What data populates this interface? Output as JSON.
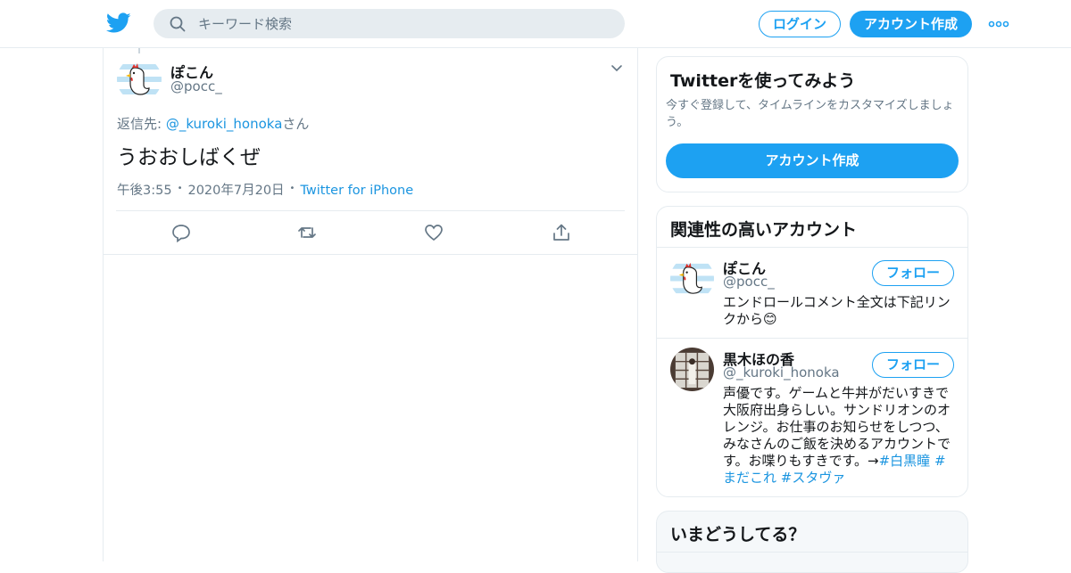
{
  "header": {
    "search_placeholder": "キーワード検索",
    "login_label": "ログイン",
    "signup_label": "アカウント作成"
  },
  "tweet": {
    "author_name": "ぽこん",
    "author_handle": "@pocc_",
    "reply_prefix": "返信先: ",
    "reply_handle": "@_kuroki_honoka",
    "reply_suffix": "さん",
    "text": "うおおしばくぜ",
    "time": "午後3:55",
    "date": "2020年7月20日",
    "source": "Twitter for iPhone"
  },
  "signup_card": {
    "title": "Twitterを使ってみよう",
    "description": "今すぐ登録して、タイムラインをカスタマイズしましょう。",
    "button_label": "アカウント作成"
  },
  "related": {
    "title": "関連性の高いアカウント",
    "follow_label": "フォロー",
    "accounts": [
      {
        "name": "ぽこん",
        "handle": "@pocc_",
        "bio": "エンドロールコメント全文は下記リンクから😊"
      },
      {
        "name": "黒木ほの香",
        "handle": "@_kuroki_honoka",
        "bio": "声優です。ゲームと牛丼がだいすきで大阪府出身らしい。サンドリオンのオレンジ。お仕事のお知らせをしつつ、みなさんのご飯を決めるアカウントです。お喋りもすきです。→",
        "tag1": "#白黒瞳",
        "tag2": "#まだこれ",
        "tag3": "#スタヴァ"
      }
    ]
  },
  "trends": {
    "title": "いまどうしてる？"
  },
  "colors": {
    "brand": "#1da1f2",
    "link": "#1b95e0",
    "secondary_text": "#657786",
    "border": "#e6ecf0"
  },
  "icons": {
    "logo": "twitter-bird-icon",
    "search": "search-icon",
    "more": "more-dots-icon",
    "caret": "chevron-down-icon",
    "reply": "reply-icon",
    "retweet": "retweet-icon",
    "like": "heart-icon",
    "share": "share-icon"
  }
}
